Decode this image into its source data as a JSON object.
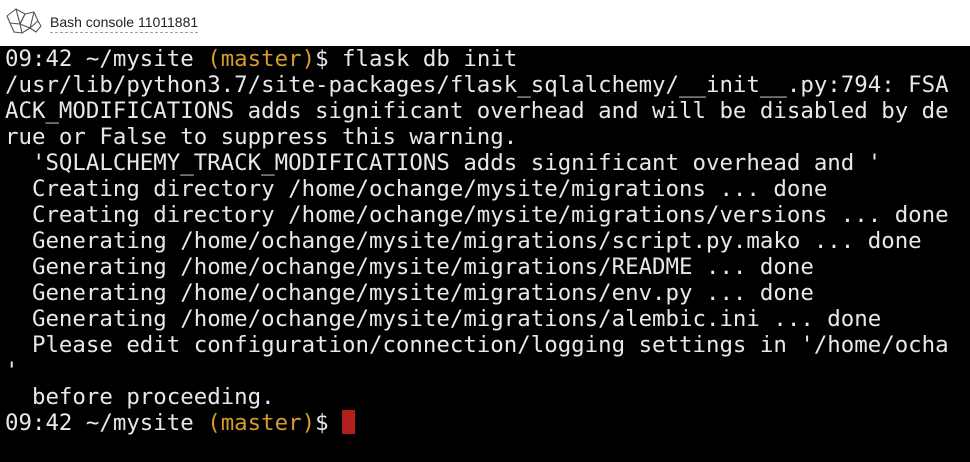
{
  "window": {
    "title": "Bash console 11011881",
    "logo_icon": "pythonanywhere-logo-icon"
  },
  "terminal": {
    "colors": {
      "background": "#000000",
      "text": "#e8e8e8",
      "branch": "#d69b2e",
      "cursor": "#b01e1e"
    },
    "prompt_1": {
      "prefix": "09:42 ~/mysite ",
      "branch": "(master)",
      "suffix": "$ ",
      "command": "flask db init"
    },
    "output": [
      "/usr/lib/python3.7/site-packages/flask_sqlalchemy/__init__.py:794: FSA",
      "ACK_MODIFICATIONS adds significant overhead and will be disabled by de",
      "rue or False to suppress this warning.",
      "  'SQLALCHEMY_TRACK_MODIFICATIONS adds significant overhead and '",
      "  Creating directory /home/ochange/mysite/migrations ... done",
      "  Creating directory /home/ochange/mysite/migrations/versions ... done",
      "  Generating /home/ochange/mysite/migrations/script.py.mako ... done",
      "  Generating /home/ochange/mysite/migrations/README ... done",
      "  Generating /home/ochange/mysite/migrations/env.py ... done",
      "  Generating /home/ochange/mysite/migrations/alembic.ini ... done",
      "  Please edit configuration/connection/logging settings in '/home/ocha",
      "'",
      "  before proceeding."
    ],
    "prompt_2": {
      "prefix": "09:42 ~/mysite ",
      "branch": "(master)",
      "suffix": "$ "
    }
  }
}
